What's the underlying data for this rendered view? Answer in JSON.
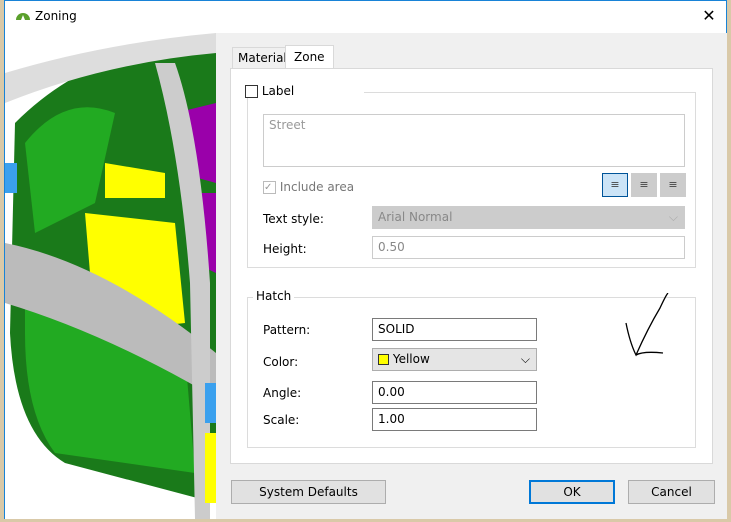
{
  "window": {
    "title": "Zoning"
  },
  "tabs": [
    {
      "label": "Material"
    },
    {
      "label": "Zone"
    }
  ],
  "label_group": {
    "checkbox_label": "Label",
    "text_value": "Street",
    "include_area_label": "Include area",
    "text_style_label": "Text style:",
    "text_style_value": "Arial Normal",
    "height_label": "Height:",
    "height_value": "0.50"
  },
  "hatch_group": {
    "title": "Hatch",
    "pattern_label": "Pattern:",
    "pattern_value": "SOLID",
    "color_label": "Color:",
    "color_value": "Yellow",
    "color_swatch": "#ffff00",
    "angle_label": "Angle:",
    "angle_value": "0.00",
    "scale_label": "Scale:",
    "scale_value": "1.00"
  },
  "buttons": {
    "system_defaults": "System Defaults",
    "ok": "OK",
    "cancel": "Cancel"
  },
  "icons": {
    "close": "✕",
    "align_left": "≡",
    "align_center": "≡",
    "align_right": "≡",
    "chevron": "⌵"
  }
}
